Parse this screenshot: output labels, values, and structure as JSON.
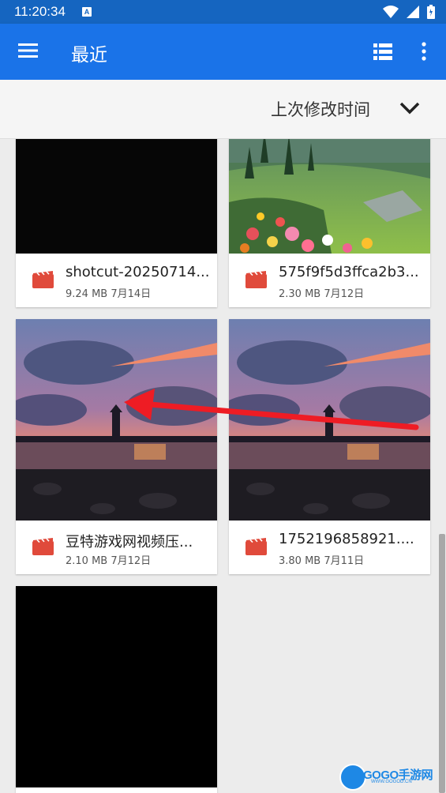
{
  "status_bar": {
    "time": "11:20:34",
    "badge": "A",
    "icons": [
      "wifi-icon",
      "signal-icon",
      "battery-icon"
    ]
  },
  "app_bar": {
    "title": "最近",
    "icons": [
      "menu-icon",
      "list-view-icon",
      "more-vert-icon"
    ]
  },
  "sort_bar": {
    "label": "上次修改时间",
    "icon": "chevron-down-icon"
  },
  "files": [
    {
      "name": "shotcut-20250714...",
      "size": "9.24 MB",
      "date": "7月14日",
      "thumb": "dark"
    },
    {
      "name": "575f9f5d3ffca2b3...",
      "size": "2.30 MB",
      "date": "7月12日",
      "thumb": "meadow"
    },
    {
      "name": "豆特游戏网视频压...",
      "size": "2.10 MB",
      "date": "7月12日",
      "thumb": "lighthouse"
    },
    {
      "name": "1752196858921....",
      "size": "3.80 MB",
      "date": "7月11日",
      "thumb": "lighthouse"
    },
    {
      "name": "",
      "size": "",
      "date": "",
      "thumb": "black"
    }
  ],
  "annotation": {
    "type": "red-arrow"
  },
  "watermark": {
    "text": "GOGO手游网",
    "sub": "WWW.GOGOD.CN"
  },
  "colors": {
    "status_bar": "#1565c0",
    "app_bar": "#1a73e8",
    "video_icon": "#e04a3b"
  }
}
